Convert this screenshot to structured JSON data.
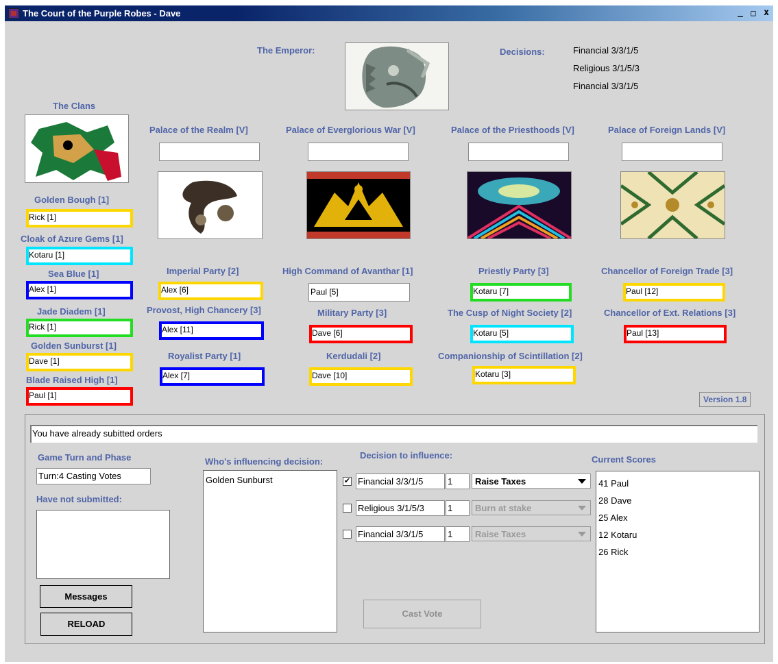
{
  "window": {
    "title": "The Court of the Purple Robes - Dave",
    "controls": [
      "_",
      "□",
      "x"
    ]
  },
  "emperor": {
    "label": "The Emperor:"
  },
  "decisions": {
    "label": "Decisions:",
    "items": [
      "Financial 3/3/1/5",
      "Religious 3/1/5/3",
      "Financial 3/3/1/5"
    ]
  },
  "clans": {
    "title": "The Clans",
    "list": [
      {
        "name": "Golden Bough [1]",
        "holder": "Rick [1]",
        "color": "#ffd700"
      },
      {
        "name": "Cloak of Azure Gems [1]",
        "holder": "Kotaru [1]",
        "color": "#00e5ff"
      },
      {
        "name": "Sea Blue [1]",
        "holder": "Alex [1]",
        "color": "#0000ff"
      },
      {
        "name": "Jade Diadem [1]",
        "holder": "Rick [1]",
        "color": "#22dd22"
      },
      {
        "name": "Golden Sunburst [1]",
        "holder": "Dave [1]",
        "color": "#ffd700"
      },
      {
        "name": "Blade Raised High [1]",
        "holder": "Paul [1]",
        "color": "#ff0000"
      }
    ]
  },
  "palaces": [
    {
      "name": "Palace of the Realm [V]",
      "value": ""
    },
    {
      "name": "Palace of Everglorious War [V]",
      "value": ""
    },
    {
      "name": "Palace of the Priesthoods [V]",
      "value": ""
    },
    {
      "name": "Palace of Foreign Lands [V]",
      "value": ""
    }
  ],
  "offices": [
    {
      "name": "Imperial Party [2]",
      "holder": "Alex [6]",
      "color": "#ffd700"
    },
    {
      "name": "Provost, High Chancery [3]",
      "holder": "Alex [11]",
      "color": "#0000ff"
    },
    {
      "name": "Royalist Party [1]",
      "holder": "Alex [7]",
      "color": "#0000ff"
    },
    {
      "name": "High Command of Avanthar [1]",
      "holder": "Paul [5]",
      "color": ""
    },
    {
      "name": "Military Party [3]",
      "holder": "Dave [6]",
      "color": "#ff0000"
    },
    {
      "name": "Kerdudali [2]",
      "holder": "Dave [10]",
      "color": "#ffd700"
    },
    {
      "name": "Priestly Party [3]",
      "holder": "Kotaru [7]",
      "color": "#22dd22"
    },
    {
      "name": "The Cusp of Night Society [2]",
      "holder": "Kotaru [5]",
      "color": "#00e5ff"
    },
    {
      "name": "Companionship of Scintillation [2]",
      "holder": "Kotaru [3]",
      "color": "#ffd700"
    },
    {
      "name": "Chancellor of Foreign Trade [3]",
      "holder": "Paul [12]",
      "color": "#ffd700"
    },
    {
      "name": "Chancellor of Ext. Relations [3]",
      "holder": "Paul [13]",
      "color": "#ff0000"
    }
  ],
  "version": "Version 1.8",
  "status_message": "You have already subitted orders",
  "game_turn": {
    "label": "Game Turn and Phase",
    "value": "Turn:4 Casting Votes"
  },
  "not_submitted": {
    "label": "Have not submitted:"
  },
  "buttons": {
    "messages": "Messages",
    "reload": "RELOAD",
    "cast_vote": "Cast Vote"
  },
  "influencing": {
    "label": "Who's influencing decision:",
    "items": [
      "Golden Sunburst"
    ]
  },
  "decision_influence": {
    "label": "Decision to influence:",
    "rows": [
      {
        "checked": "✔",
        "decision": "Financial 3/3/1/5",
        "amount": "1",
        "action": "Raise Taxes",
        "enabled": true
      },
      {
        "checked": "",
        "decision": "Religious 3/1/5/3",
        "amount": "1",
        "action": "Burn at stake",
        "enabled": false
      },
      {
        "checked": "",
        "decision": "Financial 3/3/1/5",
        "amount": "1",
        "action": "Raise Taxes",
        "enabled": false
      }
    ]
  },
  "scores": {
    "label": "Current Scores",
    "items": [
      "41  Paul",
      "28  Dave",
      "25  Alex",
      "12  Kotaru",
      "26  Rick"
    ]
  }
}
